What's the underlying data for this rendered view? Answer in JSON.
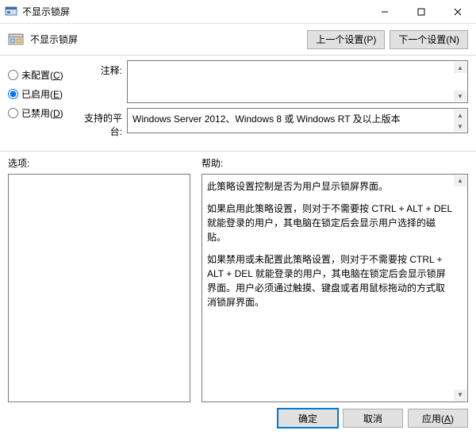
{
  "window": {
    "title": "不显示锁屏"
  },
  "toolbar": {
    "title": "不显示锁屏",
    "prev_label": "上一个设置(P)",
    "next_label": "下一个设置(N)"
  },
  "radios": {
    "not_configured": {
      "label_prefix": "未配置(",
      "mnemonic": "C",
      "label_suffix": ")"
    },
    "enabled": {
      "label_prefix": "已启用(",
      "mnemonic": "E",
      "label_suffix": ")"
    },
    "disabled": {
      "label_prefix": "已禁用(",
      "mnemonic": "D",
      "label_suffix": ")"
    },
    "selected": "enabled"
  },
  "fields": {
    "comment_label": "注释:",
    "comment_value": "",
    "platform_label": "支持的平台:",
    "platform_value": "Windows Server 2012、Windows 8 或 Windows RT 及以上版本"
  },
  "lower": {
    "options_label": "选项:",
    "help_label": "帮助:",
    "help_paragraphs": [
      "此策略设置控制是否为用户显示锁屏界面。",
      "如果启用此策略设置，则对于不需要按 CTRL + ALT + DEL  就能登录的用户，其电脑在锁定后会显示用户选择的磁贴。",
      "如果禁用或未配置此策略设置，则对于不需要按 CTRL + ALT + DEL 就能登录的用户，其电脑在锁定后会显示锁屏界面。用户必须通过触摸、键盘或者用鼠标拖动的方式取消锁屏界面。"
    ]
  },
  "buttons": {
    "ok": "确定",
    "cancel": "取消",
    "apply_prefix": "应用(",
    "apply_mnemonic": "A",
    "apply_suffix": ")"
  }
}
